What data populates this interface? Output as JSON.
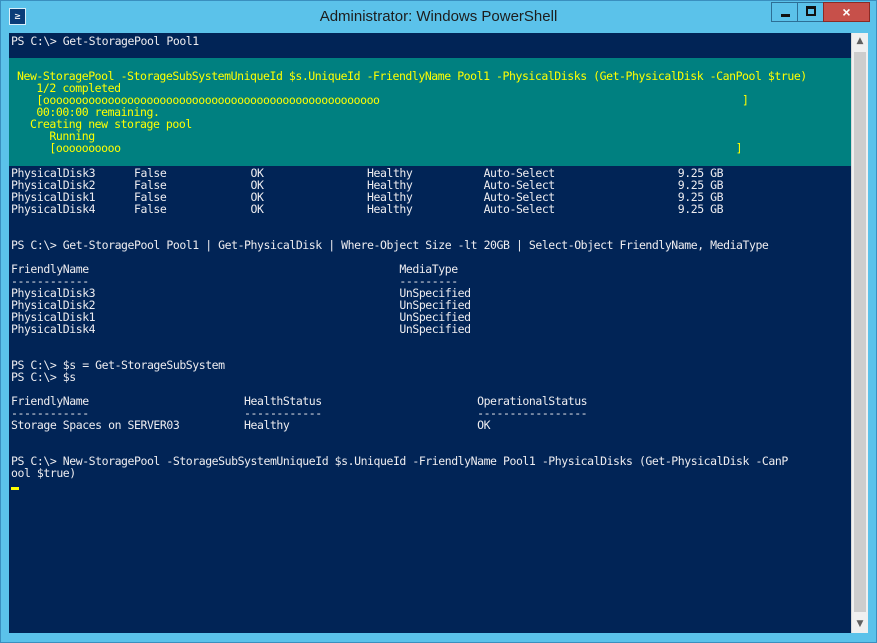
{
  "window": {
    "title": "Administrator: Windows PowerShell",
    "icon_glyph": "≥",
    "controls": {
      "close_glyph": "×"
    }
  },
  "scrollbar": {
    "up_glyph": "▲",
    "down_glyph": "▼"
  },
  "colors": {
    "console_bg": "#012456",
    "console_fg": "#eeedf0",
    "progress_bg": "#008080",
    "progress_fg": "#ffff00",
    "title_bar": "#5bc2ea",
    "close_button": "#c7504a"
  },
  "console": {
    "lines": [
      "PS C:\\> Get-StoragePool Pool1",
      "",
      "",
      "",
      "",
      "",
      "",
      "",
      "",
      "",
      "",
      "PhysicalDisk3      False             OK                Healthy           Auto-Select                   9.25 GB",
      "PhysicalDisk2      False             OK                Healthy           Auto-Select                   9.25 GB",
      "PhysicalDisk1      False             OK                Healthy           Auto-Select                   9.25 GB",
      "PhysicalDisk4      False             OK                Healthy           Auto-Select                   9.25 GB",
      "",
      "",
      "PS C:\\> Get-StoragePool Pool1 | Get-PhysicalDisk | Where-Object Size -lt 20GB | Select-Object FriendlyName, MediaType",
      "",
      "FriendlyName                                                MediaType",
      "------------                                                ---------",
      "PhysicalDisk3                                               UnSpecified",
      "PhysicalDisk2                                               UnSpecified",
      "PhysicalDisk1                                               UnSpecified",
      "PhysicalDisk4                                               UnSpecified",
      "",
      "",
      "PS C:\\> $s = Get-StorageSubSystem",
      "PS C:\\> $s",
      "",
      "FriendlyName                        HealthStatus                        OperationalStatus",
      "------------                        ------------                        -----------------",
      "Storage Spaces on SERVER03          Healthy                             OK",
      "",
      "",
      "PS C:\\> New-StoragePool -StorageSubSystemUniqueId $s.UniqueId -FriendlyName Pool1 -PhysicalDisks (Get-PhysicalDisk -CanP",
      "ool $true)"
    ],
    "progress_lines": [
      "New-StoragePool -StorageSubSystemUniqueId $s.UniqueId -FriendlyName Pool1 -PhysicalDisks (Get-PhysicalDisk -CanPool $true)",
      "   1/2 completed",
      "   [oooooooooooooooooooooooooooooooooooooooooooooooooooo                                                        ]",
      "   00:00:00 remaining.",
      "  Creating new storage pool",
      "     Running",
      "     [oooooooooo                                                                                               ]"
    ]
  }
}
